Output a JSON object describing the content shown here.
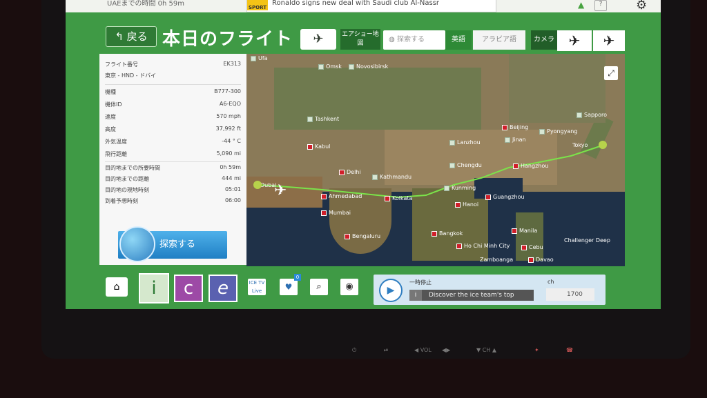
{
  "topbar": {
    "program_text": "UAEまでの時間 0h 59m",
    "news_tag": "SPORT",
    "news_text": "Ronaldo signs new deal with Saudi club Al-Nassr"
  },
  "header": {
    "back_label": "戻る",
    "title": "本日のフライト",
    "airshow_label": "エアショー地図",
    "search_placeholder": "探索する",
    "lang_english": "英語",
    "lang_arabic": "アラビア語",
    "camera_label": "カメラ"
  },
  "flight_info": [
    {
      "key": "フライト番号",
      "value": "EK313"
    },
    {
      "key": "東京 - HND - ドバイ",
      "value": ""
    },
    {
      "key": "機種",
      "value": "B777-300"
    },
    {
      "key": "機体ID",
      "value": "A6-EQO"
    },
    {
      "key": "速度",
      "value": "570 mph"
    },
    {
      "key": "高度",
      "value": "37,992 ft"
    },
    {
      "key": "外気温度",
      "value": "-44 ° C"
    },
    {
      "key": "飛行距離",
      "value": "5,090 mi"
    },
    {
      "key": "目的地までの所要時間",
      "value": "0h 59m"
    },
    {
      "key": "目的地までの距離",
      "value": "444 mi"
    },
    {
      "key": "目的地の現地時刻",
      "value": "05:01"
    },
    {
      "key": "到着予想時刻",
      "value": "06:00"
    }
  ],
  "search_button_label": "探索する",
  "map": {
    "cities": [
      "Ufa",
      "Omsk",
      "Novosibirsk",
      "Tashkent",
      "Kabul",
      "Delhi",
      "Kathmandu",
      "Beijing",
      "Pyongyang",
      "Sapporo",
      "Lanzhou",
      "Jinan",
      "Tokyo",
      "Chengdu",
      "Hangzhou",
      "Dubai",
      "Kunming",
      "Ahmedabad",
      "Kolkata",
      "Guangzhou",
      "Hanoi",
      "Mumbai",
      "Manila",
      "Bangkok",
      "Bengaluru",
      "Challenger Deep",
      "Ho Chi Minh City",
      "Cebu",
      "Zamboanga",
      "Davao"
    ]
  },
  "bottom": {
    "icetv_label": "ICE TV Live",
    "badge_count": "0",
    "player_status": "一時停止",
    "player_text": "Discover the ice team's top",
    "channel_label": "ch",
    "channel_number": "1700"
  },
  "hardware": {
    "vol": "VOL",
    "ch": "CH"
  }
}
